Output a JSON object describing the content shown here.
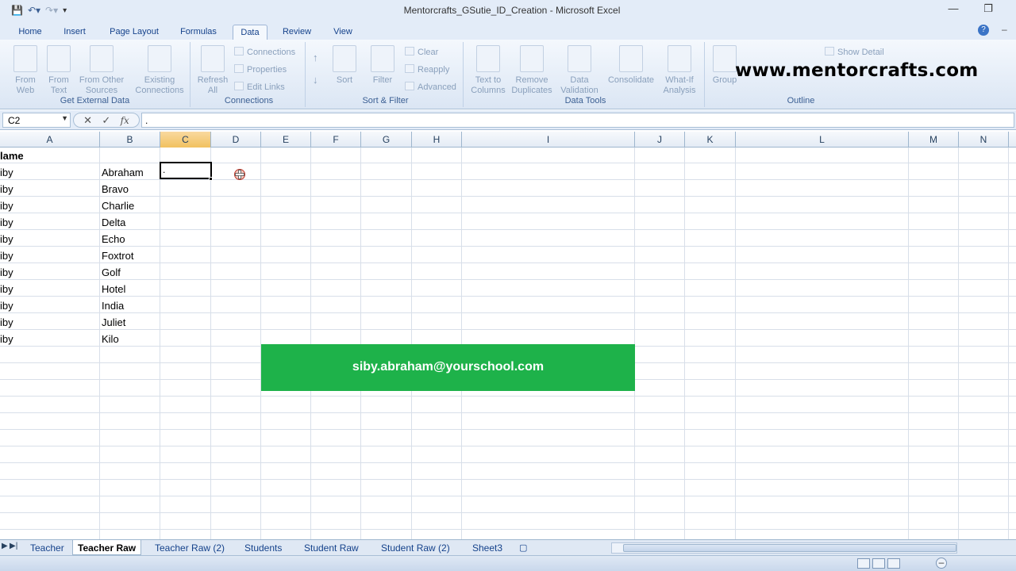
{
  "window": {
    "title": "Mentorcrafts_GSutie_ID_Creation - Microsoft Excel"
  },
  "ribbon_tabs": [
    "Home",
    "Insert",
    "Page Layout",
    "Formulas",
    "Data",
    "Review",
    "View"
  ],
  "active_tab": "Data",
  "ribbon": {
    "get_external_data": {
      "label": "Get External Data",
      "buttons": [
        "From Web",
        "From Text",
        "From Other Sources",
        "Existing Connections"
      ]
    },
    "connections": {
      "label": "Connections",
      "refresh": "Refresh All",
      "items": [
        "Connections",
        "Properties",
        "Edit Links"
      ]
    },
    "sort_filter": {
      "label": "Sort & Filter",
      "sort": "Sort",
      "filter": "Filter",
      "items": [
        "Clear",
        "Reapply",
        "Advanced"
      ]
    },
    "data_tools": {
      "label": "Data Tools",
      "buttons": [
        "Text to Columns",
        "Remove Duplicates",
        "Data Validation",
        "Consolidate",
        "What-If Analysis"
      ]
    },
    "outline": {
      "label": "Outline",
      "group": "Group",
      "show_detail": "Show Detail"
    }
  },
  "formula_bar": {
    "name_box": "C2",
    "formula": "."
  },
  "columns": [
    "A",
    "B",
    "C",
    "D",
    "E",
    "F",
    "G",
    "H",
    "I",
    "J",
    "K",
    "L",
    "M",
    "N"
  ],
  "selected_column": "C",
  "sheet": {
    "a1": "lame",
    "col_a": [
      "iby",
      "iby",
      "iby",
      "iby",
      "iby",
      "iby",
      "iby",
      "iby",
      "iby",
      "iby",
      "iby"
    ],
    "col_b": [
      "Abraham",
      "Bravo",
      "Charlie",
      "Delta",
      "Echo",
      "Foxtrot",
      "Golf",
      "Hotel",
      "India",
      "Juliet",
      "Kilo"
    ],
    "active_cell_value": "."
  },
  "banner": {
    "text": "siby.abraham@yourschool.com",
    "color": "#1eb24a"
  },
  "watermark": "www.mentorcrafts.com",
  "sheet_tabs": [
    "Teacher",
    "Teacher Raw",
    "Teacher Raw (2)",
    "Students",
    "Student Raw",
    "Student Raw (2)",
    "Sheet3"
  ],
  "active_sheet": "Teacher Raw"
}
